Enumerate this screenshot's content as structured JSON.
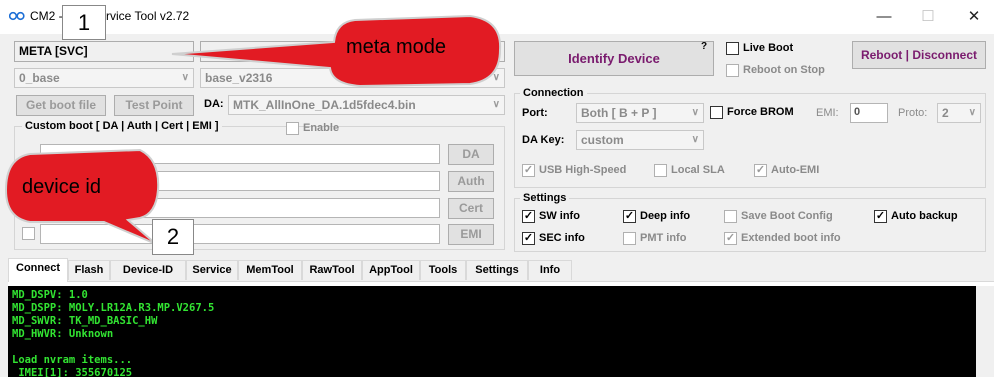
{
  "window": {
    "title": "CM2 -           ervice Tool v2.72",
    "minimize": "—",
    "maximize": "☐",
    "close": "✕"
  },
  "mode_select": "META [SVC]",
  "base_select": "0_base",
  "base_version_select": "base_v2316",
  "buttons": {
    "get_boot_file": "Get boot file",
    "test_point": "Test Point",
    "identify_device": "Identify Device",
    "reboot_disconnect": "Reboot | Disconnect",
    "da": "DA",
    "auth": "Auth",
    "cert": "Cert",
    "emi": "EMI",
    "help_mark": "?"
  },
  "da": {
    "label": "DA:",
    "value": "MTK_AllInOne_DA.1d5fdec4.bin"
  },
  "custom_boot": {
    "title": "Custom boot [ DA | Auth | Cert | EMI ]",
    "enable": "Enable"
  },
  "top_checks": {
    "live_boot": "Live Boot",
    "reboot_on_stop": "Reboot on Stop"
  },
  "connection": {
    "title": "Connection",
    "port_label": "Port:",
    "port_value": "Both [ B + P ]",
    "force_brom": "Force BROM",
    "emi_label": "EMI:",
    "emi_value": "0",
    "proto_label": "Proto:",
    "proto_value": "2",
    "da_key_label": "DA Key:",
    "da_key_value": "custom",
    "usb_high_speed": "USB High-Speed",
    "local_sla": "Local SLA",
    "auto_emi": "Auto-EMI"
  },
  "settings": {
    "title": "Settings",
    "sw_info": "SW info",
    "deep_info": "Deep info",
    "save_boot_config": "Save Boot Config",
    "auto_backup": "Auto backup",
    "sec_info": "SEC info",
    "pmt_info": "PMT info",
    "extended_boot_info": "Extended boot info"
  },
  "check_mark": "✓",
  "tabs": [
    "Connect",
    "Flash",
    "Device-ID",
    "Service",
    "MemTool",
    "RawTool",
    "AppTool",
    "Tools",
    "Settings",
    "Info"
  ],
  "console_lines": [
    "MD_DSPV: 1.0",
    "MD_DSPP: MOLY.LR12A.R3.MP.V267.5",
    "MD_SWVR: TK_MD_BASIC_HW",
    "MD_HWVR: Unknown",
    "",
    "Load nvram items...",
    " IMEI[1]: 355670125"
  ],
  "annotations": {
    "badge_1": "1",
    "badge_2": "2",
    "meta_mode": "meta mode",
    "device_id": "device id"
  },
  "colors": {
    "annotation_red": "#e21b23",
    "console_text": "#32e432",
    "accent_purple": "#7a1b6e"
  }
}
